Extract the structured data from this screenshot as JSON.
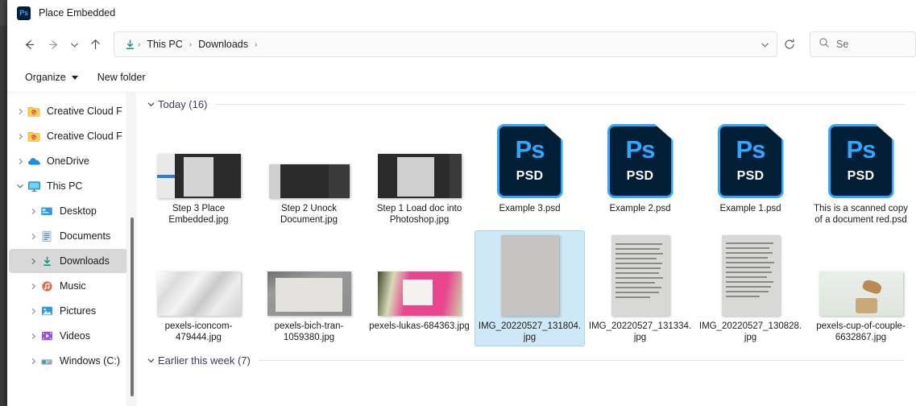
{
  "window": {
    "title": "Place Embedded",
    "app_icon": "photoshop-icon",
    "app_icon_text": "Ps"
  },
  "navbar": {
    "back_icon": "arrow-left-icon",
    "forward_icon": "arrow-right-icon",
    "recent_icon": "chevron-down-icon",
    "up_icon": "arrow-up-icon",
    "address": {
      "location_icon": "downloads-icon",
      "crumbs": [
        "This PC",
        "Downloads"
      ],
      "separator": "›",
      "dropdown_icon": "chevron-down-icon",
      "refresh_icon": "refresh-icon"
    },
    "search": {
      "icon": "search-icon",
      "placeholder": "Se"
    }
  },
  "commandbar": {
    "organize_label": "Organize",
    "new_folder_label": "New folder"
  },
  "sidebar": {
    "items": [
      {
        "label": "Creative Cloud F",
        "icon": "creative-cloud-folder-icon",
        "expanded": false,
        "indent": false,
        "selected": false
      },
      {
        "label": "Creative Cloud F",
        "icon": "creative-cloud-folder-icon",
        "expanded": false,
        "indent": false,
        "selected": false
      },
      {
        "label": "OneDrive",
        "icon": "onedrive-icon",
        "expanded": false,
        "indent": false,
        "selected": false
      },
      {
        "label": "This PC",
        "icon": "this-pc-icon",
        "expanded": true,
        "indent": false,
        "selected": false
      },
      {
        "label": "Desktop",
        "icon": "desktop-icon",
        "expanded": false,
        "indent": true,
        "selected": false
      },
      {
        "label": "Documents",
        "icon": "documents-icon",
        "expanded": false,
        "indent": true,
        "selected": false
      },
      {
        "label": "Downloads",
        "icon": "downloads-icon",
        "expanded": false,
        "indent": true,
        "selected": true
      },
      {
        "label": "Music",
        "icon": "music-icon",
        "expanded": false,
        "indent": true,
        "selected": false
      },
      {
        "label": "Pictures",
        "icon": "pictures-icon",
        "expanded": false,
        "indent": true,
        "selected": false
      },
      {
        "label": "Videos",
        "icon": "videos-icon",
        "expanded": false,
        "indent": true,
        "selected": false
      },
      {
        "label": "Windows (C:)",
        "icon": "drive-icon",
        "expanded": false,
        "indent": true,
        "selected": false
      }
    ]
  },
  "content": {
    "groups": [
      {
        "title": "Today (16)",
        "expanded": true
      },
      {
        "title": "Earlier this week (7)",
        "expanded": true
      }
    ],
    "rows": [
      [
        {
          "label": "Step 3 Place Embedded.jpg",
          "kind": "ps-screen-a",
          "selected": false
        },
        {
          "label": "Step 2 Unock Document.jpg",
          "kind": "ps-screen-b",
          "selected": false
        },
        {
          "label": "Step 1 Load doc into Photoshop.jpg",
          "kind": "ps-screen-c",
          "selected": false
        },
        {
          "label": "Example 3.psd",
          "kind": "psd",
          "selected": false
        },
        {
          "label": "Example 2.psd",
          "kind": "psd",
          "selected": false
        },
        {
          "label": "Example 1.psd",
          "kind": "psd",
          "selected": false
        },
        {
          "label": "This is a scanned copy of a document red.psd",
          "kind": "psd",
          "selected": false
        }
      ],
      [
        {
          "label": "pexels-iconcom-479444.jpg",
          "kind": "crumpled",
          "selected": false
        },
        {
          "label": "pexels-bich-tran-1059380.jpg",
          "kind": "notebook",
          "selected": false
        },
        {
          "label": "pexels-lukas-684363.jpg",
          "kind": "pink",
          "selected": false
        },
        {
          "label": "IMG_20220527_131804.jpg",
          "kind": "gray-doc",
          "selected": true
        },
        {
          "label": "IMG_20220527_131334.jpg",
          "kind": "paper-doc",
          "selected": false
        },
        {
          "label": "IMG_20220527_130828.jpg",
          "kind": "paper-doc",
          "selected": false
        },
        {
          "label": "pexels-cup-of-couple-6632867.jpg",
          "kind": "cup",
          "selected": false
        }
      ]
    ]
  },
  "colors": {
    "psd_bg": "#001E36",
    "psd_accent": "#31A8FF",
    "selection": "#cfe8f7",
    "selection_border": "#a3d3ef",
    "group_header": "#3b3b5c",
    "sidebar_selected": "#d8d8d8"
  }
}
